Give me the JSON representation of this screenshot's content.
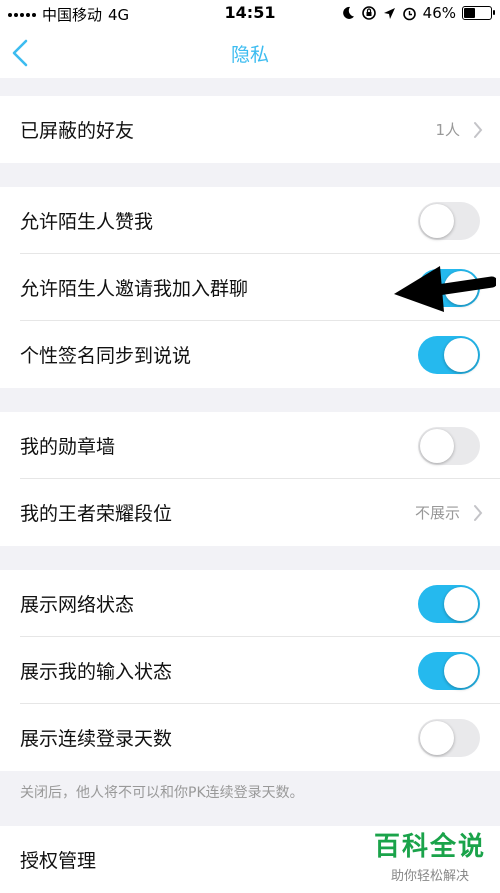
{
  "status_bar": {
    "carrier": "中国移动",
    "network": "4G",
    "time": "14:51",
    "battery_pct": "46%",
    "battery_level": 0.46
  },
  "nav": {
    "title": "隐私",
    "back_icon": "chevron-left-icon"
  },
  "sections": {
    "blocked": {
      "label": "已屏蔽的好友",
      "value": "1人"
    },
    "stranger": {
      "like_label": "允许陌生人赞我",
      "like_on": false,
      "invite_label": "允许陌生人邀请我加入群聊",
      "invite_on": true,
      "signature_label": "个性签名同步到说说",
      "signature_on": true
    },
    "profile": {
      "medal_label": "我的勋章墙",
      "medal_on": false,
      "rank_label": "我的王者荣耀段位",
      "rank_value": "不展示"
    },
    "status": {
      "network_label": "展示网络状态",
      "network_on": true,
      "typing_label": "展示我的输入状态",
      "typing_on": true,
      "login_label": "展示连续登录天数",
      "login_on": false
    },
    "note": "关闭后，他人将不可以和你PK连续登录天数。",
    "auth": {
      "label": "授权管理"
    }
  },
  "watermark": {
    "brand": "百科全说",
    "slogan": "助你轻松解决"
  },
  "colors": {
    "accent": "#3cbcf0",
    "toggle_on": "#25b9ee",
    "toggle_off": "#e9e9eb",
    "background": "#f2f2f6"
  }
}
